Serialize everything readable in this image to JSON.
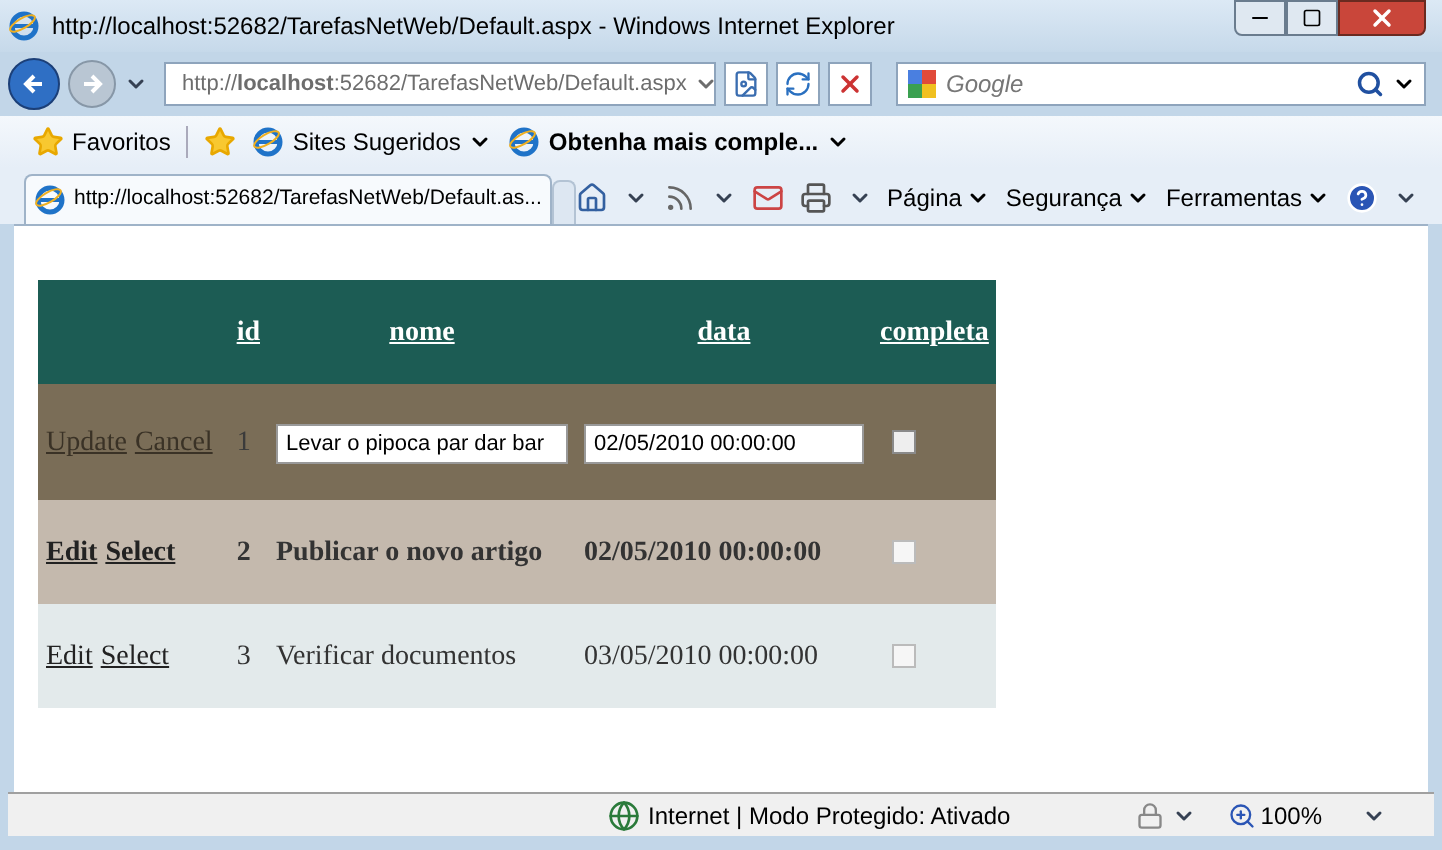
{
  "window": {
    "title": "http://localhost:52682/TarefasNetWeb/Default.aspx - Windows Internet Explorer"
  },
  "address_bar": {
    "url": "http://**localhost**:52682/TarefasNetWeb/Default.aspx"
  },
  "search": {
    "placeholder": "Google"
  },
  "favorites_bar": {
    "favorites": "Favoritos",
    "links": [
      {
        "label": "Sites Sugeridos",
        "bold": false
      },
      {
        "label": "Obtenha mais comple...",
        "bold": true
      }
    ]
  },
  "tab": {
    "title": "http://localhost:52682/TarefasNetWeb/Default.as..."
  },
  "command_bar": [
    "Página",
    "Segurança",
    "Ferramentas"
  ],
  "table": {
    "columns": [
      "id",
      "nome",
      "data",
      "completa"
    ],
    "rows": [
      {
        "kind": "edit",
        "selected": false,
        "actions": [
          "Update",
          "Cancel"
        ],
        "id": "1",
        "nome": "Levar o pipoca par dar bar",
        "data": "02/05/2010 00:00:00",
        "completa": false
      },
      {
        "kind": "view",
        "selected": true,
        "actions": [
          "Edit",
          "Select"
        ],
        "id": "2",
        "nome": "Publicar o novo artigo",
        "data": "02/05/2010 00:00:00",
        "completa": false
      },
      {
        "kind": "view",
        "selected": false,
        "actions": [
          "Edit",
          "Select"
        ],
        "id": "3",
        "nome": "Verificar documentos",
        "data": "03/05/2010 00:00:00",
        "completa": false
      }
    ]
  },
  "status_bar": {
    "text": "Internet | Modo Protegido: Ativado",
    "zoom": "100%"
  }
}
